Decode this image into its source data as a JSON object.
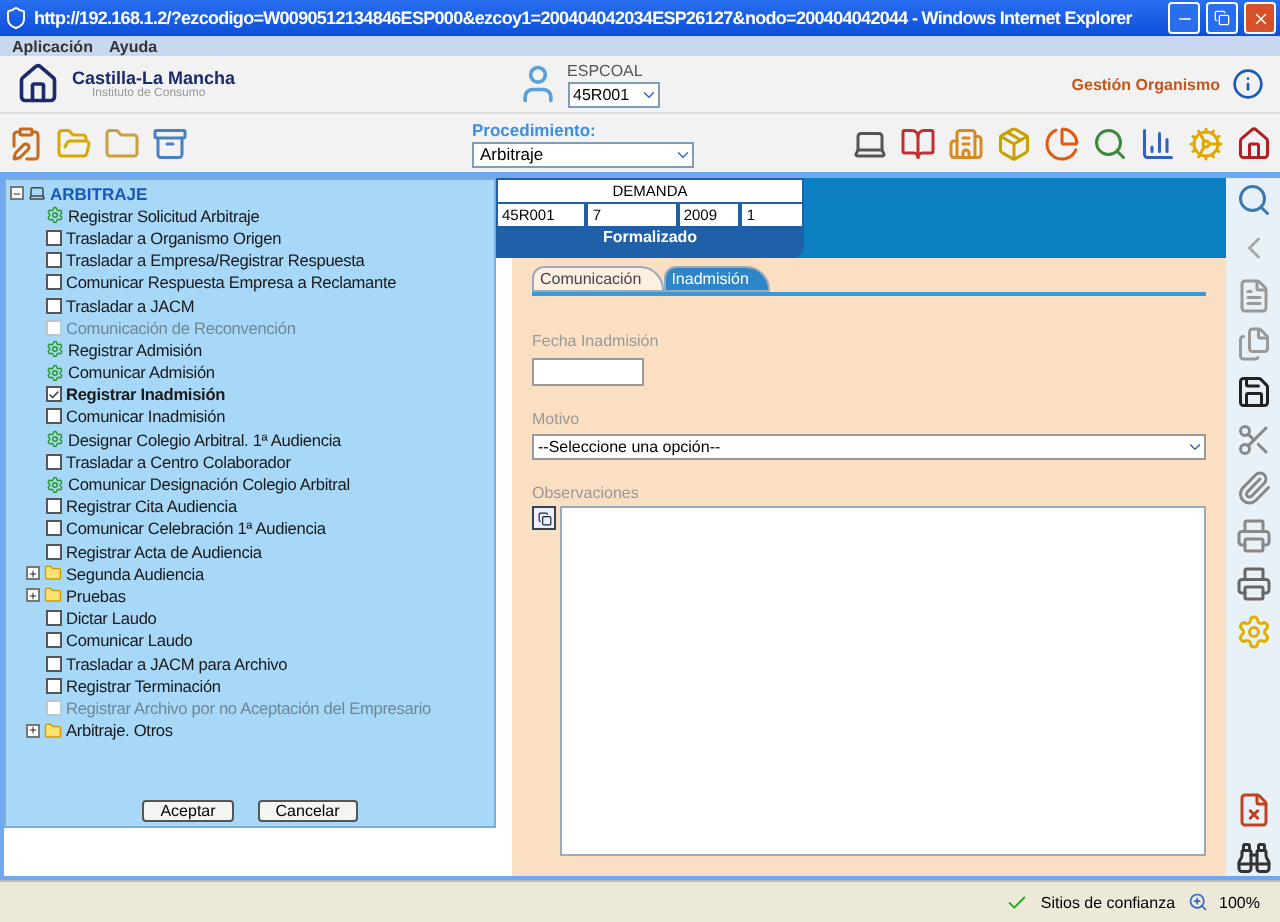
{
  "window": {
    "title": "http://192.168.1.2/?ezcodigo=W0090512134846ESP000&ezcoy1=200404042034ESP26127&nodo=200404042044 - Windows Internet Explorer"
  },
  "menu": [
    "Aplicación",
    "Ayuda"
  ],
  "header": {
    "org_name": "Castilla-La Mancha",
    "org_subtitle": "Instituto de Consumo",
    "user": "ESPCOAL",
    "unit_select": "45R001",
    "module_link": "Gestión Organismo"
  },
  "toolbar": {
    "procedure_label": "Procedimiento:",
    "procedure_value": "Arbitraje"
  },
  "tree": {
    "label": "ARBITRAJE",
    "expanded": true,
    "children": [
      {
        "label": "Registrar Solicitud Arbitraje",
        "kind": "done"
      },
      {
        "label": "Trasladar a Organismo Origen",
        "kind": "task",
        "checked": false,
        "disabled": false
      },
      {
        "label": "Trasladar a Empresa/Registrar Respuesta",
        "kind": "task",
        "checked": false,
        "disabled": false
      },
      {
        "label": "Comunicar Respuesta Empresa a Reclamante",
        "kind": "task",
        "checked": false,
        "disabled": false
      },
      {
        "label": "Trasladar a JACM",
        "kind": "task",
        "checked": false,
        "disabled": false
      },
      {
        "label": "Comunicación de Reconvención",
        "kind": "task",
        "checked": false,
        "disabled": true
      },
      {
        "label": "Registrar Admisión",
        "kind": "done"
      },
      {
        "label": "Comunicar Admisión",
        "kind": "done"
      },
      {
        "label": "Registrar Inadmisión",
        "kind": "task",
        "checked": true,
        "disabled": false
      },
      {
        "label": "Comunicar Inadmisión",
        "kind": "task",
        "checked": false,
        "disabled": false
      },
      {
        "label": "Designar Colegio Arbitral. 1ª Audiencia",
        "kind": "done"
      },
      {
        "label": "Trasladar a Centro Colaborador",
        "kind": "task",
        "checked": false,
        "disabled": false
      },
      {
        "label": "Comunicar Designación Colegio Arbitral",
        "kind": "done"
      },
      {
        "label": "Registrar Cita Audiencia",
        "kind": "task",
        "checked": false,
        "disabled": false
      },
      {
        "label": "Comunicar Celebración 1ª Audiencia",
        "kind": "task",
        "checked": false,
        "disabled": false
      },
      {
        "label": "Registrar Acta de Audiencia",
        "kind": "task",
        "checked": false,
        "disabled": false
      },
      {
        "label": "Segunda Audiencia",
        "kind": "folder",
        "expanded": false
      },
      {
        "label": "Pruebas",
        "kind": "folder",
        "expanded": false
      },
      {
        "label": "Dictar Laudo",
        "kind": "task",
        "checked": false,
        "disabled": false
      },
      {
        "label": "Comunicar Laudo",
        "kind": "task",
        "checked": false,
        "disabled": false
      },
      {
        "label": "Trasladar a JACM para Archivo",
        "kind": "task",
        "checked": false,
        "disabled": false
      },
      {
        "label": "Registrar Terminación",
        "kind": "task",
        "checked": false,
        "disabled": false
      },
      {
        "label": "Registrar Archivo por no Aceptación del Empresario",
        "kind": "task",
        "checked": false,
        "disabled": true
      },
      {
        "label": "Arbitraje. Otros",
        "kind": "folder",
        "expanded": false
      }
    ]
  },
  "tree_buttons": [
    "Aceptar",
    "Cancelar"
  ],
  "case_card": {
    "title": "DEMANDA",
    "fields": [
      "45R001",
      "7",
      "2009",
      "1"
    ],
    "status": "Formalizado"
  },
  "tabs": [
    {
      "label": "Comunicación",
      "selected": false
    },
    {
      "label": "Inadmisión",
      "selected": true
    }
  ],
  "form": {
    "date_label": "Fecha Inadmisión",
    "motivo_label": "Motivo",
    "motivo_value": "--Seleccione una opción--",
    "observaciones_label": "Observaciones"
  },
  "status_bar": {
    "zone": "Sitios de confianza",
    "zoom": "100%"
  }
}
